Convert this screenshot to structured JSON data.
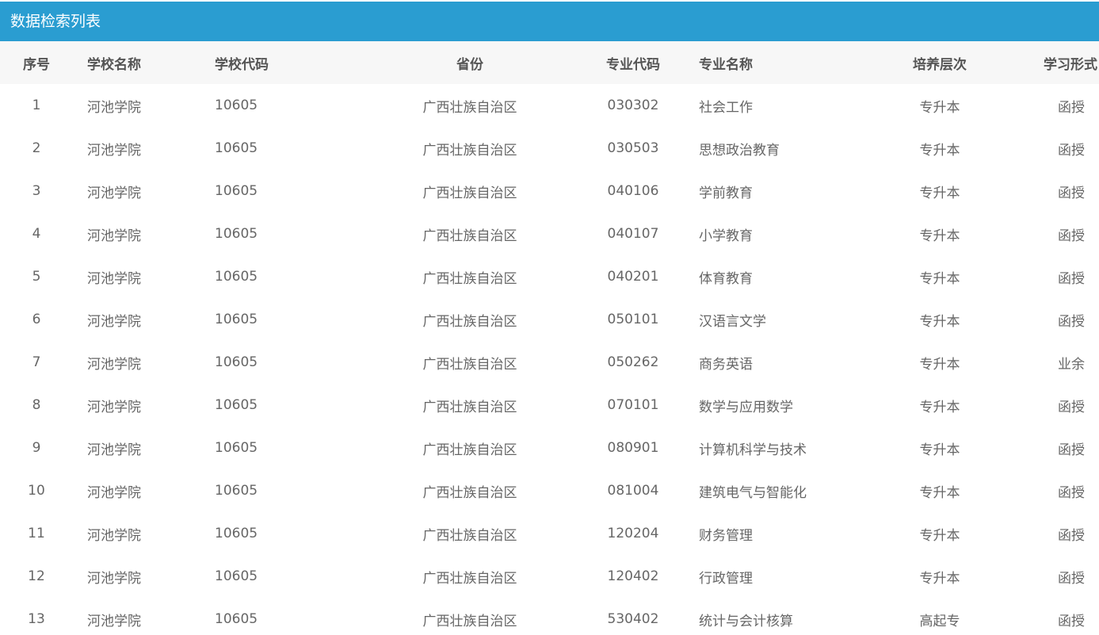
{
  "panel": {
    "title": "数据检索列表"
  },
  "table": {
    "headers": {
      "no": "序号",
      "school_name": "学校名称",
      "school_code": "学校代码",
      "province": "省份",
      "major_code": "专业代码",
      "major_name": "专业名称",
      "level": "培养层次",
      "study_form": "学习形式"
    },
    "rows": [
      {
        "no": "1",
        "school_name": "河池学院",
        "school_code": "10605",
        "province": "广西壮族自治区",
        "major_code": "030302",
        "major_name": "社会工作",
        "level": "专升本",
        "study_form": "函授"
      },
      {
        "no": "2",
        "school_name": "河池学院",
        "school_code": "10605",
        "province": "广西壮族自治区",
        "major_code": "030503",
        "major_name": "思想政治教育",
        "level": "专升本",
        "study_form": "函授"
      },
      {
        "no": "3",
        "school_name": "河池学院",
        "school_code": "10605",
        "province": "广西壮族自治区",
        "major_code": "040106",
        "major_name": "学前教育",
        "level": "专升本",
        "study_form": "函授"
      },
      {
        "no": "4",
        "school_name": "河池学院",
        "school_code": "10605",
        "province": "广西壮族自治区",
        "major_code": "040107",
        "major_name": "小学教育",
        "level": "专升本",
        "study_form": "函授"
      },
      {
        "no": "5",
        "school_name": "河池学院",
        "school_code": "10605",
        "province": "广西壮族自治区",
        "major_code": "040201",
        "major_name": "体育教育",
        "level": "专升本",
        "study_form": "函授"
      },
      {
        "no": "6",
        "school_name": "河池学院",
        "school_code": "10605",
        "province": "广西壮族自治区",
        "major_code": "050101",
        "major_name": "汉语言文学",
        "level": "专升本",
        "study_form": "函授"
      },
      {
        "no": "7",
        "school_name": "河池学院",
        "school_code": "10605",
        "province": "广西壮族自治区",
        "major_code": "050262",
        "major_name": "商务英语",
        "level": "专升本",
        "study_form": "业余"
      },
      {
        "no": "8",
        "school_name": "河池学院",
        "school_code": "10605",
        "province": "广西壮族自治区",
        "major_code": "070101",
        "major_name": "数学与应用数学",
        "level": "专升本",
        "study_form": "函授"
      },
      {
        "no": "9",
        "school_name": "河池学院",
        "school_code": "10605",
        "province": "广西壮族自治区",
        "major_code": "080901",
        "major_name": "计算机科学与技术",
        "level": "专升本",
        "study_form": "函授"
      },
      {
        "no": "10",
        "school_name": "河池学院",
        "school_code": "10605",
        "province": "广西壮族自治区",
        "major_code": "081004",
        "major_name": "建筑电气与智能化",
        "level": "专升本",
        "study_form": "函授"
      },
      {
        "no": "11",
        "school_name": "河池学院",
        "school_code": "10605",
        "province": "广西壮族自治区",
        "major_code": "120204",
        "major_name": "财务管理",
        "level": "专升本",
        "study_form": "函授"
      },
      {
        "no": "12",
        "school_name": "河池学院",
        "school_code": "10605",
        "province": "广西壮族自治区",
        "major_code": "120402",
        "major_name": "行政管理",
        "level": "专升本",
        "study_form": "函授"
      },
      {
        "no": "13",
        "school_name": "河池学院",
        "school_code": "10605",
        "province": "广西壮族自治区",
        "major_code": "530402",
        "major_name": "统计与会计核算",
        "level": "高起专",
        "study_form": "函授"
      }
    ]
  },
  "colors": {
    "title_bar": "#2a9dd1",
    "header_bg": "#f7f7f7",
    "text": "#666666"
  }
}
